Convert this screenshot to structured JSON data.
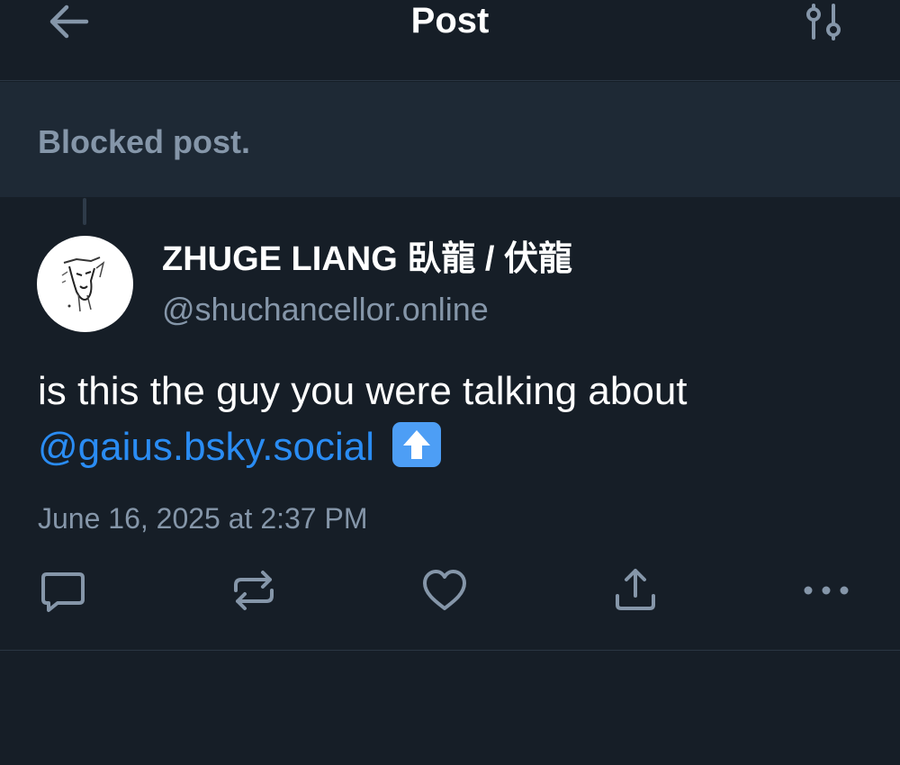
{
  "header": {
    "title": "Post",
    "back_icon": "arrow-left-icon",
    "settings_icon": "sliders-icon"
  },
  "blocked_banner": {
    "text": "Blocked post."
  },
  "post": {
    "author_name": "ZHUGE LIANG 臥龍 / 伏龍",
    "author_handle": "@shuchancellor.online",
    "text": "is this the guy you were talking about",
    "mention": "@gaius.bsky.social",
    "emoji": "up-arrow-emoji",
    "timestamp": "June 16, 2025 at 2:37 PM"
  },
  "actions": [
    {
      "name": "reply",
      "icon": "comment-icon"
    },
    {
      "name": "repost",
      "icon": "repost-icon"
    },
    {
      "name": "like",
      "icon": "heart-icon"
    },
    {
      "name": "share",
      "icon": "share-icon"
    },
    {
      "name": "more",
      "icon": "more-icon"
    }
  ],
  "colors": {
    "background": "#161e27",
    "banner": "#1e2935",
    "muted_text": "#8596a9",
    "link": "#2a8cf3",
    "icon": "#8596a9"
  }
}
